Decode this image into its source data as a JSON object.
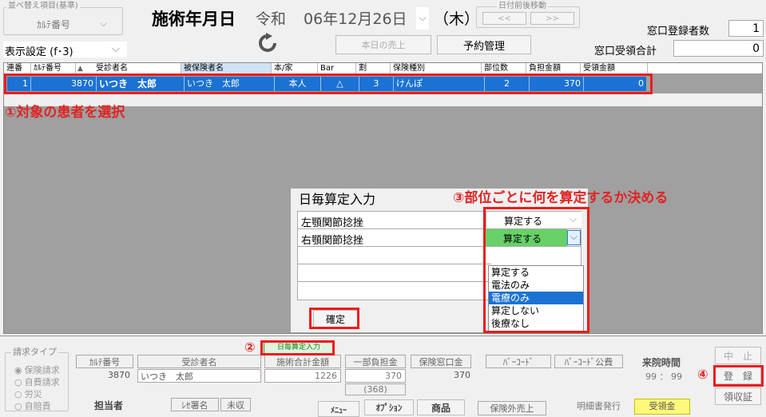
{
  "sort": {
    "group_label": "並べ替え項目(基準)",
    "value": "ｶﾙﾃ番号"
  },
  "display_setting": {
    "value": "表示設定 (f･3)"
  },
  "header": {
    "date_label": "施術年月日",
    "era": "令和",
    "date": "06年12月26日",
    "weekday": "（木）",
    "date_nav_label": "日付前後移動",
    "prev": "<<",
    "next": ">>"
  },
  "toolbar": {
    "today_sales": "本日の売上",
    "reservation": "予約管理"
  },
  "counter": {
    "registered_label": "窓口登録者数",
    "registered_value": "1",
    "received_label": "窓口受領合計",
    "received_value": "0"
  },
  "table": {
    "headers": [
      "連番",
      "ｶﾙﾃ番号",
      "受診者名",
      "被保険者名",
      "本/家",
      "Bar",
      "割",
      "保険種別",
      "部位数",
      "負担金額",
      "受領金額"
    ],
    "rows": [
      [
        "1",
        "3870",
        "いつき　太郎",
        "いつき　太郎",
        "本人",
        "△",
        "3",
        "けんぽ",
        "2",
        "370",
        "0"
      ]
    ]
  },
  "annotations": {
    "a1": "①対象の患者を選択",
    "a2": "②",
    "a3": "③部位ごとに何を算定するか決める",
    "a4": "④"
  },
  "daily_calc": {
    "title": "日毎算定入力",
    "rows": [
      {
        "site": "左顎関節捻挫",
        "value": "算定する"
      },
      {
        "site": "右顎関節捻挫",
        "value": "算定する"
      }
    ],
    "confirm": "確定",
    "options": [
      "算定する",
      "電法のみ",
      "電療のみ",
      "算定しない",
      "後療なし"
    ],
    "highlighted": "電療のみ"
  },
  "bottom": {
    "billing_type_label": "請求タイプ",
    "billing_types": [
      "保険請求",
      "自費請求",
      "労災",
      "自賠責"
    ],
    "chart_no_label": "ｶﾙﾃ番号",
    "chart_no": "3870",
    "patient_label": "受診者名",
    "patient": "いつき　太郎",
    "total_label": "施術合計金額",
    "total": "1226",
    "partial_label": "一部負担金",
    "partial": "370",
    "partial_sub": "(368)",
    "window_label": "保険窓口金",
    "window": "370",
    "barcode": "ﾊﾞｰｺｰﾄﾞ",
    "barcode_public": "ﾊﾞｰｺｰﾄﾞ公費",
    "visit_time_label": "来院時間",
    "visit_time": "99 ： 99",
    "daily_calc_button": "日毎算定入力",
    "staff_label": "担当者",
    "receipt_name": "ﾚｾ署名",
    "unpaid": "未収",
    "menu": "ﾒﾆｭｰ",
    "option": "ｵﾌﾟｼｮﾝ",
    "product": "商品",
    "non_insurance": "保険外売上",
    "statement": "明細書発行",
    "accept": "受領金",
    "stop": "中　止",
    "register": "登　録",
    "receipt": "領収証"
  }
}
